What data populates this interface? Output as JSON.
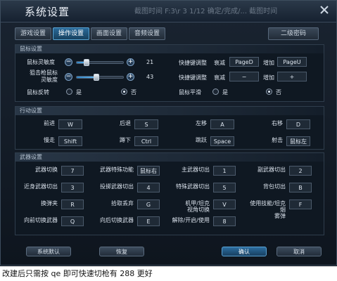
{
  "window": {
    "title": "系统设置",
    "background_text": "截图时间  F:3\\r 3 1/12  确定/完成/... 截图时间"
  },
  "tabs": [
    {
      "label": "游戏设置",
      "active": false
    },
    {
      "label": "操作设置",
      "active": true
    },
    {
      "label": "画面设置",
      "active": false
    },
    {
      "label": "音频设置",
      "active": false
    }
  ],
  "secondary_password_label": "二级密码",
  "mouse_settings": {
    "header": "鼠标设置",
    "sensitivity": {
      "label": "鼠标灵敏度",
      "value": "21",
      "level": 0.21
    },
    "sniper_sensitivity": {
      "label": "狙击枪鼠标\n灵敏度",
      "value": "43",
      "level": 0.43
    },
    "invert": {
      "label": "鼠标反转",
      "yes": "是",
      "no": "否",
      "selected": "否"
    },
    "hotkey1": {
      "label": "快捷键调整",
      "decrease": "衰减",
      "decrease_key": "PageD",
      "increase": "增加",
      "increase_key": "PageU"
    },
    "hotkey2": {
      "label": "快捷键调整",
      "decrease": "衰减",
      "decrease_key": "−",
      "increase": "增加",
      "increase_key": "+"
    },
    "smooth": {
      "label": "鼠标平滑",
      "yes": "是",
      "no": "否",
      "selected": "否"
    }
  },
  "movement_settings": {
    "header": "行动设置",
    "rows": [
      [
        {
          "label": "前进",
          "key": "W"
        },
        {
          "label": "后退",
          "key": "S"
        },
        {
          "label": "左移",
          "key": "A"
        },
        {
          "label": "右移",
          "key": "D"
        }
      ],
      [
        {
          "label": "慢走",
          "key": "Shift"
        },
        {
          "label": "蹲下",
          "key": "Ctrl"
        },
        {
          "label": "跳跃",
          "key": "Space"
        },
        {
          "label": "射击",
          "key": "鼠标左"
        }
      ]
    ]
  },
  "weapon_settings": {
    "header": "武器设置",
    "rows": [
      [
        {
          "label": "武器切换",
          "key": "7"
        },
        {
          "label": "武器特殊功能",
          "key": "鼠标右"
        },
        {
          "label": "主武器切出",
          "key": "1"
        },
        {
          "label": "副武器切出",
          "key": "2"
        }
      ],
      [
        {
          "label": "近身武器切出",
          "key": "3"
        },
        {
          "label": "投掷武器切出",
          "key": "4"
        },
        {
          "label": "特殊武器切出",
          "key": "5"
        },
        {
          "label": "背包切出",
          "key": "B"
        }
      ],
      [
        {
          "label": "换弹夹",
          "key": "R"
        },
        {
          "label": "拾取丢弃",
          "key": "G"
        },
        {
          "label": "机甲/坦克\n视角切换",
          "key": "V"
        },
        {
          "label": "使用技能/坦克烟\n雾弹",
          "key": "F"
        }
      ],
      [
        {
          "label": "向前切换武器",
          "key": "Q"
        },
        {
          "label": "向后切换武器",
          "key": "E"
        },
        {
          "label": "解除/开启/使用",
          "key": "8"
        }
      ]
    ]
  },
  "footer": {
    "default_label": "系统默认",
    "restore_label": "恢复",
    "ok_label": "确认",
    "cancel_label": "取消"
  },
  "caption": "改建后只需按 qe 即可快速切枪有 288 更好",
  "colors": {
    "accent": "#2f84c6",
    "active_tab": "#2a6a9a"
  }
}
